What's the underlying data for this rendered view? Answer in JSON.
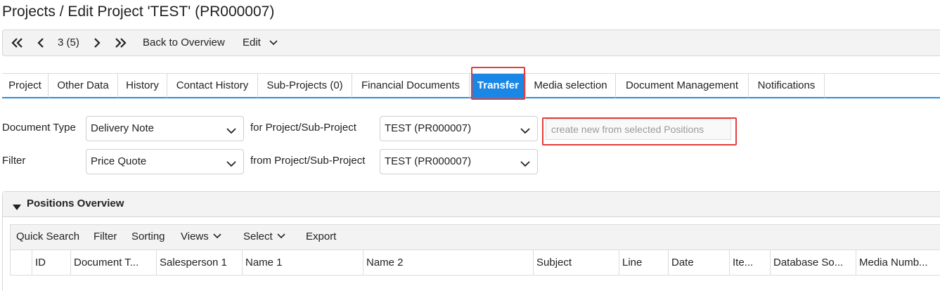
{
  "page": {
    "title": "Projects / Edit Project 'TEST' (PR000007)"
  },
  "toolbar": {
    "first_icon": "double-chevron-left-icon",
    "prev_icon": "chevron-left-icon",
    "record_position": "3 (5)",
    "next_icon": "chevron-right-icon",
    "last_icon": "double-chevron-right-icon",
    "back_label": "Back to Overview",
    "edit_label": "Edit"
  },
  "tabs": [
    {
      "label": "Project"
    },
    {
      "label": "Other Data"
    },
    {
      "label": "History"
    },
    {
      "label": "Contact History"
    },
    {
      "label": "Sub-Projects (0)"
    },
    {
      "label": "Financial Documents"
    },
    {
      "label": "Transfer",
      "active": true
    },
    {
      "label": "Media selection"
    },
    {
      "label": "Document Management"
    },
    {
      "label": "Notifications"
    }
  ],
  "form": {
    "document_type_label": "Document Type",
    "document_type_value": "Delivery Note",
    "for_project_label": "for Project/Sub-Project",
    "for_project_value": "TEST (PR000007)",
    "create_button_label": "create new from selected Positions",
    "filter_label": "Filter",
    "filter_value": "Price Quote",
    "from_project_label": "from Project/Sub-Project",
    "from_project_value": "TEST (PR000007)"
  },
  "positions": {
    "title": "Positions Overview",
    "toolbar": {
      "quick_search": "Quick Search",
      "filter": "Filter",
      "sorting": "Sorting",
      "views": "Views",
      "select": "Select",
      "export": "Export"
    },
    "columns": [
      "ID",
      "Document T...",
      "Salesperson 1",
      "Name 1",
      "Name 2",
      "Subject",
      "Line",
      "Date",
      "Ite...",
      "Database So...",
      "Media Numb..."
    ]
  },
  "colors": {
    "accent": "#1a87e6",
    "highlight": "#e53c3c",
    "tab_underline": "#2a8fd6"
  }
}
